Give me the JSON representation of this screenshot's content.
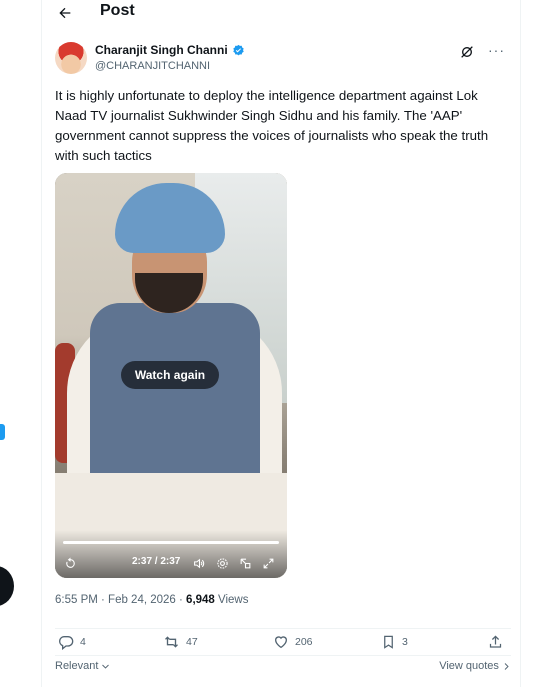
{
  "header": {
    "title": "Post"
  },
  "author": {
    "display_name": "Charanjit Singh Channi",
    "handle": "@CHARANJITCHANNI",
    "verified": true
  },
  "tweet": {
    "text": "It is highly unfortunate to deploy the intelligence department against Lok Naad TV journalist Sukhwinder Singh Sidhu and his family. The 'AAP' government cannot suppress the voices of journalists who speak the truth with such tactics"
  },
  "video": {
    "overlay_label": "Watch again",
    "time": "2:37 / 2:37",
    "progress": 1.0
  },
  "meta": {
    "timestamp": "6:55 PM · Feb 24, 2026 · ",
    "views_count": "6,948",
    "views_label": " Views"
  },
  "actions": {
    "replies": "4",
    "reposts": "47",
    "likes": "206",
    "bookmarks": "3"
  },
  "footer": {
    "sort_label": "Relevant",
    "view_quotes": "View quotes"
  },
  "colors": {
    "accent": "#1d9bf0",
    "text_primary": "#0f1419",
    "text_secondary": "#536471"
  }
}
